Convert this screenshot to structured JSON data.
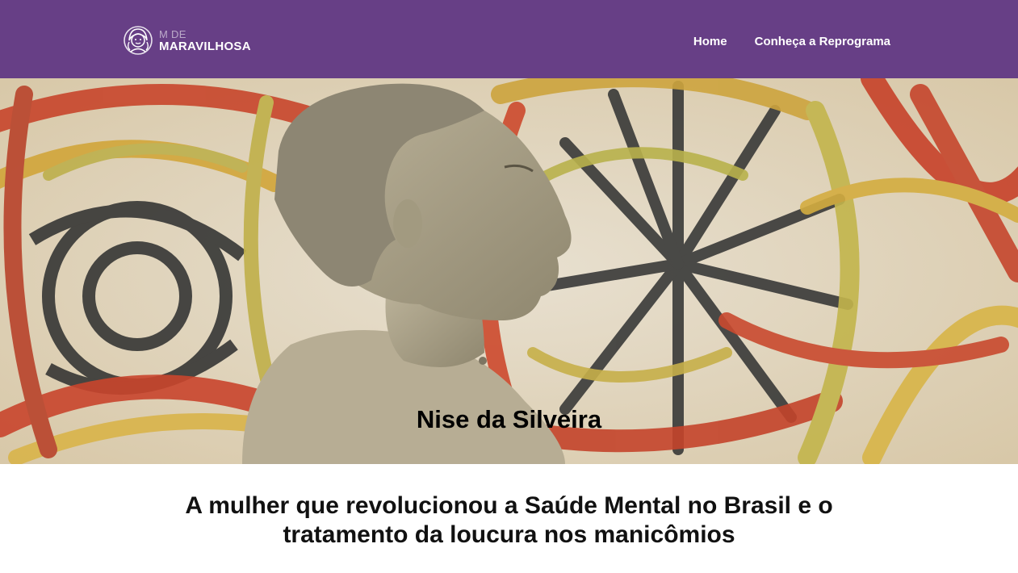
{
  "header": {
    "logo_top": "M DE",
    "logo_bottom": "MARAVILHOSA",
    "nav": [
      {
        "label": "Home"
      },
      {
        "label": "Conheça a Reprograma"
      }
    ]
  },
  "hero": {
    "title": "Nise da Silveira",
    "image_description": "Sepia portrait photo of an elderly woman in profile over a colorful abstract painting with circular brushstrokes"
  },
  "article": {
    "subtitle_line1": "A mulher que revolucionou a Saúde Mental no Brasil e o",
    "subtitle_line2": "tratamento da loucura nos manicômios"
  },
  "colors": {
    "header_bg": "#673f86",
    "nav_text": "#ffffff",
    "hero_title": "#000000"
  },
  "icons": {
    "logo": "woman-face-icon"
  }
}
